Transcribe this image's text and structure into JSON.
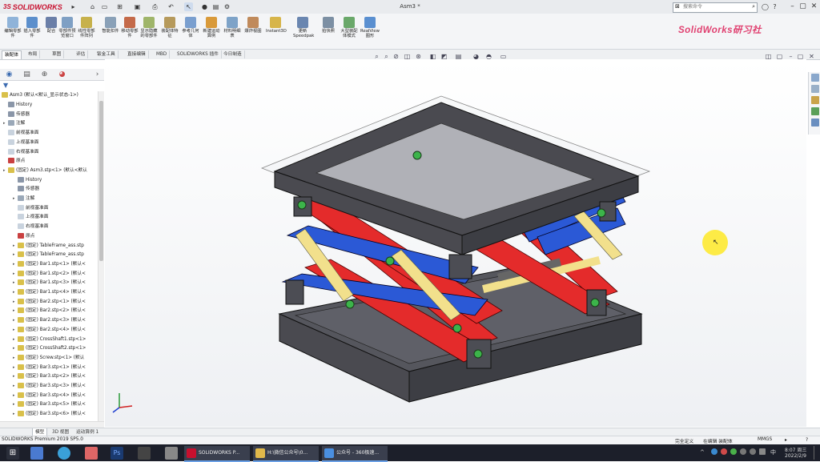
{
  "app": {
    "logo_text": "SOLIDWORKS",
    "document_title": "Asm3 *",
    "search_placeholder": "搜索命令",
    "help_icon": "?",
    "watermark": "SolidWorks研习社"
  },
  "ribbon": {
    "buttons": [
      {
        "label": "编辑零部件",
        "icon": "edit-component-icon",
        "color": "#8fb3d9"
      },
      {
        "label": "插入零部件",
        "icon": "insert-component-icon",
        "color": "#5c8fcc"
      },
      {
        "label": "配合",
        "icon": "mate-icon",
        "color": "#6b7fa8"
      },
      {
        "label": "零部件预览窗口",
        "icon": "component-preview-icon",
        "color": "#7fa0c4"
      },
      {
        "label": "线性零部件阵列",
        "icon": "linear-pattern-icon",
        "color": "#c7b14b"
      },
      {
        "label": "智能扣件",
        "icon": "smart-fastener-icon",
        "color": "#8aa1b8"
      },
      {
        "label": "移动零部件",
        "icon": "move-component-icon",
        "color": "#c46a4a"
      },
      {
        "label": "显示隐藏的零部件",
        "icon": "show-hidden-icon",
        "color": "#9fb56a"
      },
      {
        "label": "装配体特征",
        "icon": "assembly-feature-icon",
        "color": "#b69a5c"
      },
      {
        "label": "参考几何体",
        "icon": "reference-geometry-icon",
        "color": "#7a9fcf"
      },
      {
        "label": "新建运动算例",
        "icon": "motion-study-icon",
        "color": "#d99a3a"
      },
      {
        "label": "材料明细表",
        "icon": "bom-icon",
        "color": "#7ea3c8"
      },
      {
        "label": "爆炸视图",
        "icon": "exploded-view-icon",
        "color": "#c08a5b"
      },
      {
        "label": "Instant3D",
        "icon": "instant3d-icon",
        "color": "#d7b54a"
      },
      {
        "label": "更新Speedpak",
        "icon": "speedpak-icon",
        "color": "#6a86b0"
      },
      {
        "label": "拍快照",
        "icon": "snapshot-icon",
        "color": "#7c8fa3"
      },
      {
        "label": "大型装配体模式",
        "icon": "large-assembly-icon",
        "color": "#6aa86a"
      },
      {
        "label": "RealView图形",
        "icon": "realview-icon",
        "color": "#5a8fd0"
      }
    ]
  },
  "command_tabs": [
    {
      "label": "装配体",
      "active": true
    },
    {
      "label": "布局"
    },
    {
      "label": "草图"
    },
    {
      "label": "评估"
    },
    {
      "label": "钣金工具"
    },
    {
      "label": "直接编辑"
    },
    {
      "label": "MBD"
    },
    {
      "label": "SOLIDWORKS 插件"
    },
    {
      "label": "今日制造"
    }
  ],
  "feature_tree": {
    "root": "Asm3 (默认<默认_显示状态-1>)",
    "items": [
      {
        "label": "History",
        "indent": 1,
        "icon": "history-icon",
        "color": "#8a96a8"
      },
      {
        "label": "传感器",
        "indent": 1,
        "icon": "sensor-icon",
        "color": "#8a96a8"
      },
      {
        "label": "注解",
        "indent": 1,
        "expand": true,
        "icon": "annotation-icon",
        "color": "#9aa8b8"
      },
      {
        "label": "前视基准面",
        "indent": 1,
        "icon": "plane-icon",
        "color": "#c9d3de"
      },
      {
        "label": "上视基准面",
        "indent": 1,
        "icon": "plane-icon",
        "color": "#c9d3de"
      },
      {
        "label": "右视基准面",
        "indent": 1,
        "icon": "plane-icon",
        "color": "#c9d3de"
      },
      {
        "label": "原点",
        "indent": 1,
        "icon": "origin-icon",
        "color": "#c94040"
      },
      {
        "label": "(固定) Asm3.stp<1> (默认<默认",
        "indent": 1,
        "expand": true,
        "icon": "subassembly-icon",
        "color": "#d9c04a"
      },
      {
        "label": "History",
        "indent": 2,
        "icon": "history-icon",
        "color": "#8a96a8"
      },
      {
        "label": "传感器",
        "indent": 2,
        "icon": "sensor-icon",
        "color": "#8a96a8"
      },
      {
        "label": "注解",
        "indent": 2,
        "expand": true,
        "icon": "annotation-icon",
        "color": "#9aa8b8"
      },
      {
        "label": "前视基准面",
        "indent": 2,
        "icon": "plane-icon",
        "color": "#c9d3de"
      },
      {
        "label": "上视基准面",
        "indent": 2,
        "icon": "plane-icon",
        "color": "#c9d3de"
      },
      {
        "label": "右视基准面",
        "indent": 2,
        "icon": "plane-icon",
        "color": "#c9d3de"
      },
      {
        "label": "原点",
        "indent": 2,
        "icon": "origin-icon",
        "color": "#c94040"
      },
      {
        "label": "(固定) TableFrame_ass.stp",
        "indent": 2,
        "expand": true,
        "icon": "part-icon",
        "color": "#d9c04a"
      },
      {
        "label": "(固定) TableFrame_ass.stp",
        "indent": 2,
        "expand": true,
        "icon": "part-icon",
        "color": "#d9c04a"
      },
      {
        "label": "(固定) Bar1.stp<1> (默认<",
        "indent": 2,
        "expand": true,
        "icon": "part-icon",
        "color": "#d9c04a"
      },
      {
        "label": "(固定) Bar1.stp<2> (默认<",
        "indent": 2,
        "expand": true,
        "icon": "part-icon",
        "color": "#d9c04a"
      },
      {
        "label": "(固定) Bar1.stp<3> (默认<",
        "indent": 2,
        "expand": true,
        "icon": "part-icon",
        "color": "#d9c04a"
      },
      {
        "label": "(固定) Bar1.stp<4> (默认<",
        "indent": 2,
        "expand": true,
        "icon": "part-icon",
        "color": "#d9c04a"
      },
      {
        "label": "(固定) Bar2.stp<1> (默认<",
        "indent": 2,
        "expand": true,
        "icon": "part-icon",
        "color": "#d9c04a"
      },
      {
        "label": "(固定) Bar2.stp<2> (默认<",
        "indent": 2,
        "expand": true,
        "icon": "part-icon",
        "color": "#d9c04a"
      },
      {
        "label": "(固定) Bar2.stp<3> (默认<",
        "indent": 2,
        "expand": true,
        "icon": "part-icon",
        "color": "#d9c04a"
      },
      {
        "label": "(固定) Bar2.stp<4> (默认<",
        "indent": 2,
        "expand": true,
        "icon": "part-icon",
        "color": "#d9c04a"
      },
      {
        "label": "(固定) CrossShaft1.stp<1>",
        "indent": 2,
        "expand": true,
        "icon": "part-icon",
        "color": "#d9c04a"
      },
      {
        "label": "(固定) CrossShaft2.stp<1>",
        "indent": 2,
        "expand": true,
        "icon": "part-icon",
        "color": "#d9c04a"
      },
      {
        "label": "(固定) Screw.stp<1> (默认",
        "indent": 2,
        "expand": true,
        "icon": "part-icon",
        "color": "#d9c04a"
      },
      {
        "label": "(固定) Bar3.stp<1> (默认<",
        "indent": 2,
        "expand": true,
        "icon": "part-icon",
        "color": "#d9c04a"
      },
      {
        "label": "(固定) Bar3.stp<2> (默认<",
        "indent": 2,
        "expand": true,
        "icon": "part-icon",
        "color": "#d9c04a"
      },
      {
        "label": "(固定) Bar3.stp<3> (默认<",
        "indent": 2,
        "expand": true,
        "icon": "part-icon",
        "color": "#d9c04a"
      },
      {
        "label": "(固定) Bar3.stp<4> (默认<",
        "indent": 2,
        "expand": true,
        "icon": "part-icon",
        "color": "#d9c04a"
      },
      {
        "label": "(固定) Bar3.stp<5> (默认<",
        "indent": 2,
        "expand": true,
        "icon": "part-icon",
        "color": "#d9c04a"
      },
      {
        "label": "(固定) Bar3.stp<6> (默认<",
        "indent": 2,
        "expand": true,
        "icon": "part-icon",
        "color": "#d9c04a"
      }
    ]
  },
  "bottom_tabs": [
    {
      "label": "模型",
      "active": true
    },
    {
      "label": "3D 视图"
    },
    {
      "label": "运动算例 1"
    }
  ],
  "statusbar": {
    "app_version": "SOLIDWORKS Premium 2019 SP5.0",
    "state": "完全定义",
    "mode": "在编辑 装配体",
    "units": "MMGS"
  },
  "taskbar": {
    "windows": [
      {
        "label": "SOLIDWORKS P...",
        "color": "#c8102e"
      },
      {
        "label": "H:\\微信公众号\\0...",
        "color": "#e0b84a"
      },
      {
        "label": "公众号 - 360极速...",
        "color": "#4a8fe0"
      }
    ],
    "time": "8:07 周三",
    "date": "2022/2/9",
    "ime": "中"
  },
  "model_colors": {
    "frame": "#4a4a50",
    "red_bar": "#e42b2b",
    "blue_bar": "#2b59d6",
    "yellow_shaft": "#f2e08c",
    "green_bolt": "#3cb44a",
    "cursor_highlight": "#ffe600"
  }
}
